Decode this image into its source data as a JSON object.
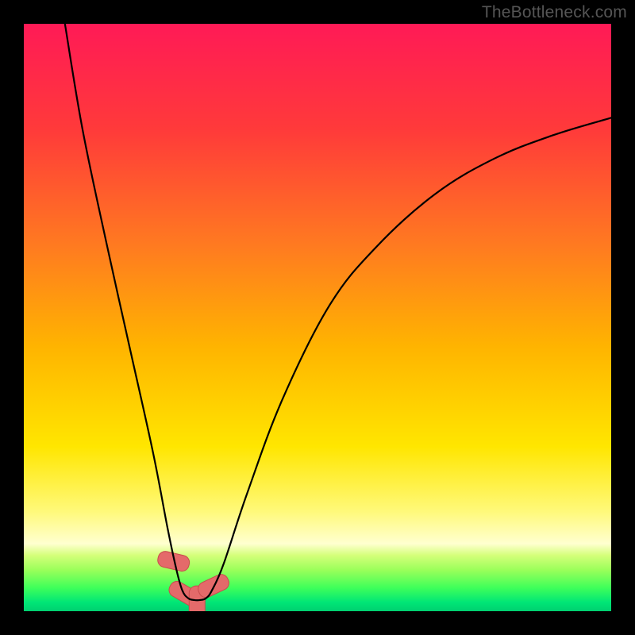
{
  "watermark": "TheBottleneck.com",
  "chart_data": {
    "type": "line",
    "title": "",
    "xlabel": "",
    "ylabel": "",
    "xlim": [
      0,
      100
    ],
    "ylim": [
      0,
      100
    ],
    "grid": false,
    "legend": false,
    "series": [
      {
        "name": "curve",
        "x": [
          7,
          10,
          14,
          18,
          22,
          24.5,
          26,
          27,
          28,
          29,
          30,
          31,
          32,
          34,
          38,
          44,
          52,
          60,
          70,
          80,
          90,
          100
        ],
        "y": [
          100,
          82,
          63,
          45,
          27,
          14,
          7,
          3.5,
          2.2,
          1.9,
          1.9,
          2.2,
          3.5,
          8,
          20,
          36,
          52,
          62,
          71,
          77,
          81,
          84
        ]
      }
    ],
    "markers": [
      {
        "x": 25.5,
        "y": 8.5,
        "angle": -77
      },
      {
        "x": 27.3,
        "y": 3.0,
        "angle": -60
      },
      {
        "x": 29.5,
        "y": 1.6,
        "angle": 0
      },
      {
        "x": 32.3,
        "y": 4.3,
        "angle": 65
      }
    ],
    "gradient_stops": [
      {
        "offset": 0.0,
        "color": "#ff1a56"
      },
      {
        "offset": 0.18,
        "color": "#ff3a3a"
      },
      {
        "offset": 0.38,
        "color": "#ff7b20"
      },
      {
        "offset": 0.55,
        "color": "#ffb400"
      },
      {
        "offset": 0.72,
        "color": "#ffe600"
      },
      {
        "offset": 0.83,
        "color": "#fff97a"
      },
      {
        "offset": 0.885,
        "color": "#ffffd0"
      },
      {
        "offset": 0.905,
        "color": "#d4ff7a"
      },
      {
        "offset": 0.93,
        "color": "#9aff5a"
      },
      {
        "offset": 0.96,
        "color": "#3fff5a"
      },
      {
        "offset": 0.985,
        "color": "#00e676"
      },
      {
        "offset": 1.0,
        "color": "#00d070"
      }
    ],
    "marker_style": {
      "fill": "#e46a6a",
      "stroke": "#c84c4c",
      "rx": 9,
      "width": 20,
      "height": 40
    },
    "curve_style": {
      "stroke": "#000000",
      "width": 2.2
    }
  }
}
